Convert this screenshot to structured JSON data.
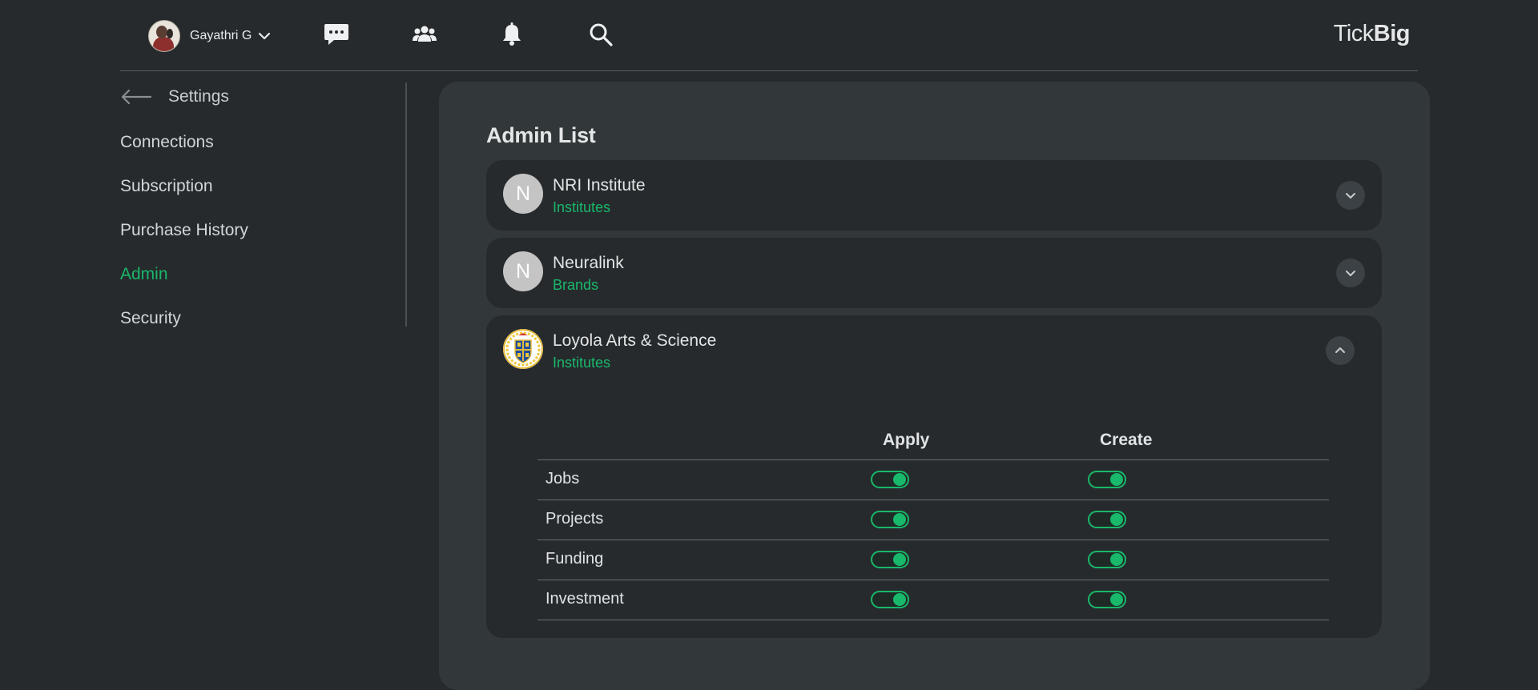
{
  "header": {
    "user_name": "Gayathri G",
    "brand_light": "Tick",
    "brand_bold": "Big",
    "icons": [
      "chat-icon",
      "community-icon",
      "bell-icon",
      "search-icon"
    ]
  },
  "sidebar": {
    "back_label": "Settings",
    "items": [
      {
        "label": "Connections",
        "active": false
      },
      {
        "label": "Subscription",
        "active": false
      },
      {
        "label": "Purchase History",
        "active": false
      },
      {
        "label": "Admin",
        "active": true
      },
      {
        "label": "Security",
        "active": false
      }
    ]
  },
  "main": {
    "title": "Admin List",
    "orgs": [
      {
        "initial": "N",
        "name": "NRI Institute",
        "type": "Institutes",
        "expanded": false
      },
      {
        "initial": "N",
        "name": "Neuralink",
        "type": "Brands",
        "expanded": false
      },
      {
        "logo": "college-crest",
        "name": "Loyola Arts & Science",
        "type": "Institutes",
        "expanded": true
      }
    ],
    "permissions": {
      "columns": [
        "Apply",
        "Create"
      ],
      "rows": [
        {
          "label": "Jobs",
          "apply": true,
          "create": true
        },
        {
          "label": "Projects",
          "apply": true,
          "create": true
        },
        {
          "label": "Funding",
          "apply": true,
          "create": true
        },
        {
          "label": "Investment",
          "apply": true,
          "create": true
        }
      ]
    }
  },
  "colors": {
    "background": "#262a2d",
    "panel": "#323839",
    "accent": "#19b86a"
  }
}
